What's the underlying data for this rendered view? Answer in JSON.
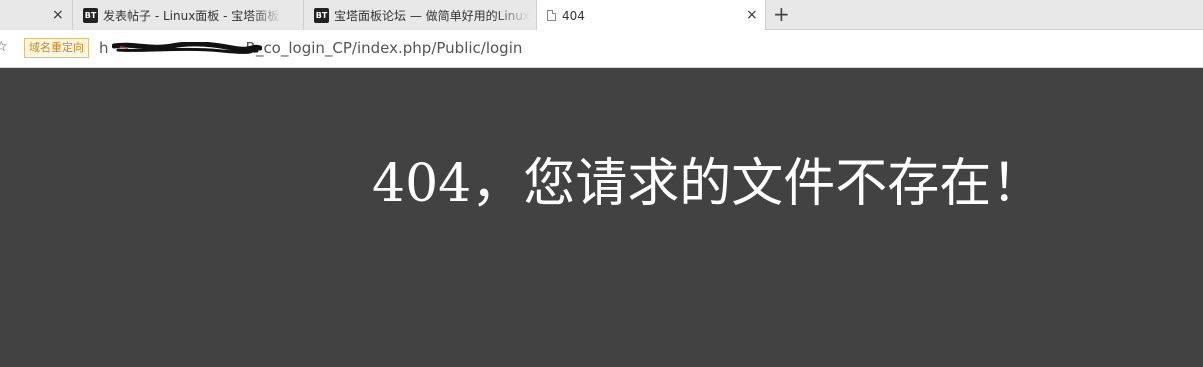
{
  "tabs": [
    {
      "favicon": "BT",
      "title": "发表帖子 - Linux面板 - 宝塔面板",
      "close_label": "×"
    },
    {
      "favicon": "BT",
      "title": "宝塔面板论坛 — 做简单好用的Linux面板",
      "close_label": ""
    },
    {
      "favicon": "page-icon",
      "title": "404",
      "close_label": "×"
    }
  ],
  "new_tab_label": "+",
  "address_bar": {
    "badge": "域名重定向",
    "url_prefix": "h",
    "url_visible": "R_co_login_CP/index.php/Public/login",
    "star_glyph": "☆"
  },
  "content": {
    "message": "404，您请求的文件不存在！"
  },
  "colors": {
    "page_background": "#424242",
    "tab_strip": "#e8e8e8",
    "badge_text": "#c8862a"
  }
}
